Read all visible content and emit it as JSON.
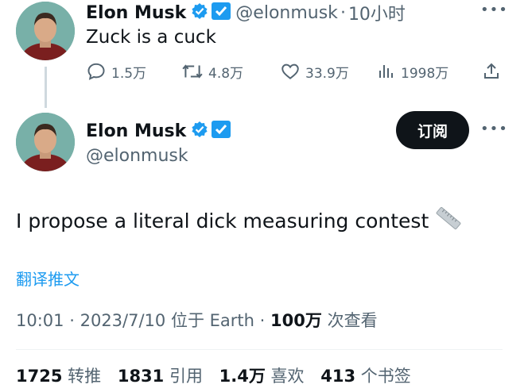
{
  "reply": {
    "name": "Elon Musk",
    "handle": "@elonmusk",
    "separator": "·",
    "time": "10小时",
    "text": "Zuck is a cuck",
    "actions": {
      "replies": "1.5万",
      "retweets": "4.8万",
      "likes": "33.9万",
      "views": "1998万"
    }
  },
  "tweet": {
    "name": "Elon Musk",
    "handle": "@elonmusk",
    "subscribe_label": "订阅",
    "text": "I propose a literal dick measuring contest",
    "translate_label": "翻译推文",
    "meta": {
      "time": "10:01",
      "sep1": "·",
      "date": "2023/7/10",
      "location_prefix": "位于",
      "location": "Earth",
      "sep2": "·",
      "views": "100万",
      "views_label": "次查看"
    },
    "stats": {
      "retweets": "1725",
      "retweets_label": "转推",
      "quotes": "1831",
      "quotes_label": "引用",
      "likes": "1.4万",
      "likes_label": "喜欢",
      "bookmarks": "413",
      "bookmarks_label": "个书签"
    }
  },
  "colors": {
    "accent": "#1d9bf0",
    "text": "#0f1419",
    "muted": "#536471",
    "verified_badge": "#1d9bf0",
    "subscribe_bg": "#0f1419"
  },
  "icons": [
    "reply-icon",
    "retweet-icon",
    "like-icon",
    "views-icon",
    "share-icon",
    "verified-icon",
    "more-icon",
    "ruler-emoji"
  ]
}
